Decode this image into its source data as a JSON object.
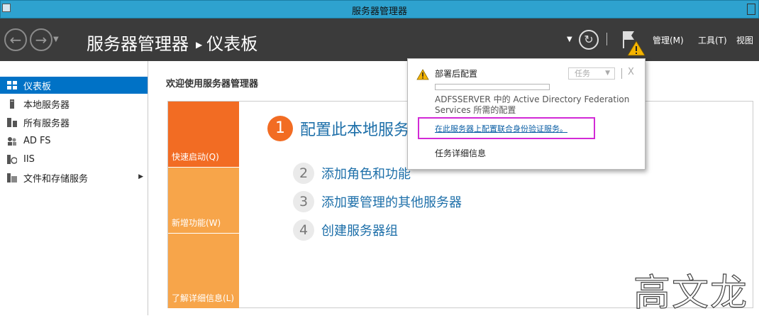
{
  "window": {
    "title": "服务器管理器"
  },
  "header": {
    "breadcrumb_root": "服务器管理器",
    "breadcrumb_page": "仪表板",
    "menus": [
      "管理(M)",
      "工具(T)",
      "视图"
    ]
  },
  "sidebar": {
    "items": [
      {
        "label": "仪表板",
        "icon": "dashboard-icon"
      },
      {
        "label": "本地服务器",
        "icon": "server-icon"
      },
      {
        "label": "所有服务器",
        "icon": "servers-icon"
      },
      {
        "label": "AD FS",
        "icon": "adfs-icon"
      },
      {
        "label": "IIS",
        "icon": "iis-icon"
      },
      {
        "label": "文件和存储服务",
        "icon": "storage-icon"
      }
    ]
  },
  "main": {
    "welcome": "欢迎使用服务器管理器",
    "tiles": [
      "快速启动(Q)",
      "新增功能(W)",
      "了解详细信息(L)"
    ],
    "tasks": [
      {
        "num": "1",
        "label": "配置此本地服务器"
      },
      {
        "num": "2",
        "label": "添加角色和功能"
      },
      {
        "num": "3",
        "label": "添加要管理的其他服务器"
      },
      {
        "num": "4",
        "label": "创建服务器组"
      }
    ]
  },
  "notification": {
    "title": "部署后配置",
    "task_dropdown": "任务",
    "close": "X",
    "progress": 0.0,
    "description": "ADFSSERVER 中的 Active Directory Federation Services 所需的配置",
    "link": "在此服务器上配置联合身份验证服务。",
    "details": "任务详细信息"
  },
  "watermark": "高文龙",
  "colors": {
    "titlebar": "#2ea2cf",
    "header": "#3b3b3b",
    "selection": "#0072c6",
    "tile_primary": "#f26c23",
    "tile_secondary": "#f7a54a",
    "link": "#1d6fa9",
    "highlight_box": "#d22ad6"
  }
}
